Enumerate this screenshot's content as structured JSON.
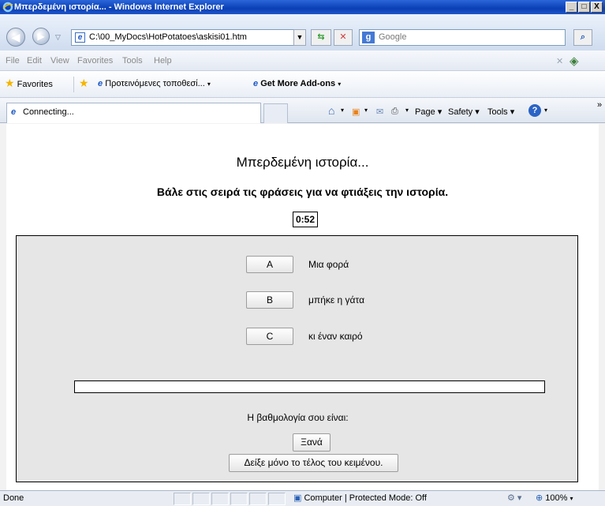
{
  "window": {
    "title": "Μπερδεμένη ιστορία... - Windows Internet Explorer",
    "controls": [
      "_",
      "□",
      "X"
    ]
  },
  "addressbar": {
    "url": "C:\\00_MyDocs\\HotPotatoes\\askisi01.htm",
    "search_placeholder": "Google"
  },
  "menu": {
    "items": [
      "File",
      "Edit",
      "View",
      "Favorites",
      "Tools",
      "Help"
    ]
  },
  "favorites": {
    "label": "Favorites",
    "suggested_sites": "Προτεινόμενες τοποθεσί...",
    "addons": "Get More Add-ons"
  },
  "tab": {
    "title": "Connecting..."
  },
  "commandbar": {
    "page": "Page",
    "safety": "Safety",
    "tools": "Tools"
  },
  "content": {
    "title": "Μπερδεμένη ιστορία...",
    "subtitle": "Βάλε στις σειρά τις φράσεις για να φτιάξεις την ιστορία.",
    "timer": "0:52",
    "rows": [
      {
        "letter": "A",
        "phrase": "Μια φορά"
      },
      {
        "letter": "B",
        "phrase": "μπήκε η γάτα"
      },
      {
        "letter": "C",
        "phrase": "κι έναν καιρό"
      }
    ],
    "score_label": "Η βαθμολογία σου είναι:",
    "again_button": "Ξανά",
    "show_end_button": "Δείξε μόνο το τέλος του κειμένου."
  },
  "statusbar": {
    "status": "Done",
    "zone": "Computer | Protected Mode: Off",
    "zoom": "100%"
  },
  "colors": {
    "titlebar": "#0a3fb5",
    "exercise_bg": "#e6e6e6",
    "content_bg": "#ffffff"
  }
}
